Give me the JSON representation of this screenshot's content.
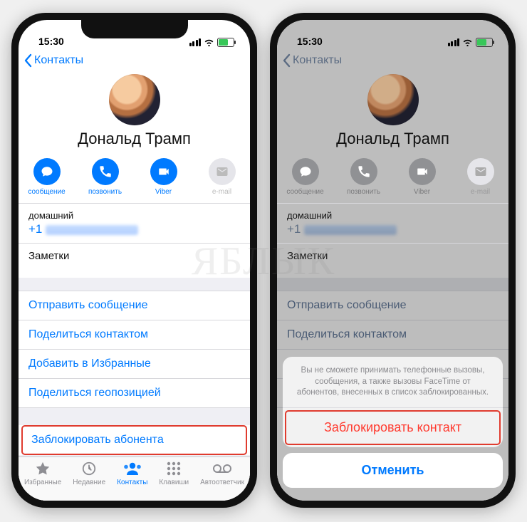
{
  "watermark": "ЯБЛЫК",
  "status": {
    "time": "15:30"
  },
  "nav": {
    "back_label": "Контакты"
  },
  "contact": {
    "name": "Дональд Трамп"
  },
  "quick_actions": [
    {
      "id": "сообщение",
      "label": "сообщение",
      "enabled": true,
      "icon": "message"
    },
    {
      "id": "позвонить",
      "label": "позвонить",
      "enabled": true,
      "icon": "call"
    },
    {
      "id": "viber",
      "label": "Viber",
      "enabled": true,
      "icon": "video"
    },
    {
      "id": "email",
      "label": "e-mail",
      "enabled": false,
      "icon": "mail"
    }
  ],
  "phone_section": {
    "label": "домашний",
    "number_prefix": "+1"
  },
  "notes_label": "Заметки",
  "actions_group1": [
    "Отправить сообщение",
    "Поделиться контактом",
    "Добавить в Избранные",
    "Поделиться геопозицией"
  ],
  "block_action": "Заблокировать абонента",
  "tabs": [
    {
      "id": "Избранные",
      "label": "Избранные",
      "icon": "star"
    },
    {
      "id": "Недавние",
      "label": "Недавние",
      "icon": "clock"
    },
    {
      "id": "Контакты",
      "label": "Контакты",
      "icon": "contacts",
      "active": true
    },
    {
      "id": "Клавиши",
      "label": "Клавиши",
      "icon": "keypad"
    },
    {
      "id": "Автоответчик",
      "label": "Автоответчик",
      "icon": "voicemail"
    }
  ],
  "sheet": {
    "message": "Вы не сможете принимать телефонные вызовы, сообщения, а также вызовы FaceTime от абонентов, внесенных в список заблокированных.",
    "block": "Заблокировать контакт",
    "cancel": "Отменить"
  }
}
